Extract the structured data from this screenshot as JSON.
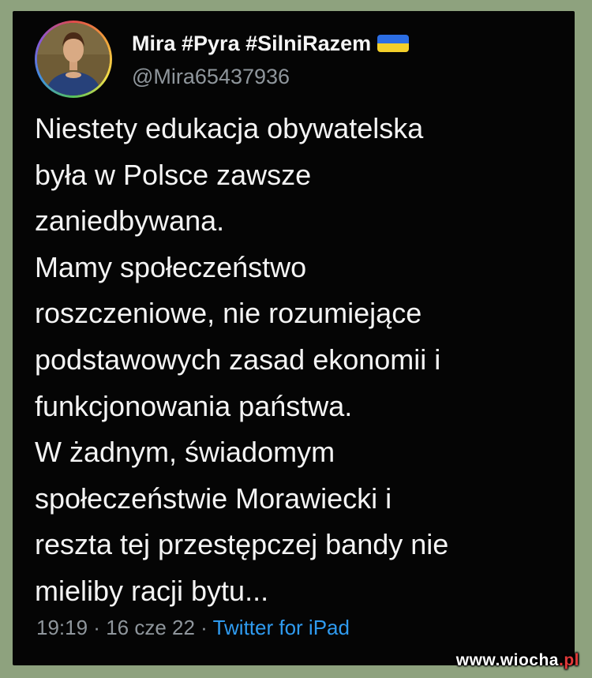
{
  "tweet": {
    "author": {
      "display_name": "Mira #Pyra #SilniRazem",
      "handle": "@Mira65437936",
      "flag_icon": "ukraine-flag-icon",
      "avatar": "profile-portrait-avatar",
      "colors": {
        "name": "#f5f5f5",
        "handle": "#8f969c",
        "flag_blue": "#2c6ee4",
        "flag_yellow": "#f3cf2b"
      }
    },
    "lines": [
      "Niestety edukacja obywatelska",
      "była w Polsce zawsze",
      "zaniedbywana.",
      "Mamy społeczeństwo",
      "roszczeniowe, nie rozumiejące",
      "podstawowych zasad ekonomii i",
      "funkcjonowania państwa.",
      "W żadnym, świadomym",
      "społeczeństwie Morawiecki i",
      "reszta tej przestępczej bandy nie",
      "mieliby racji bytu..."
    ],
    "meta": {
      "time": "19:19",
      "separator": " · ",
      "date": "16 cze 22",
      "source": "Twitter for iPad"
    },
    "colors": {
      "background": "#050505",
      "text": "#f4f4f4",
      "link": "#2f9bf0"
    }
  },
  "watermark": {
    "domain": "www.wiocha",
    "tld": ".pl"
  },
  "page": {
    "background": "#8ea27e"
  }
}
